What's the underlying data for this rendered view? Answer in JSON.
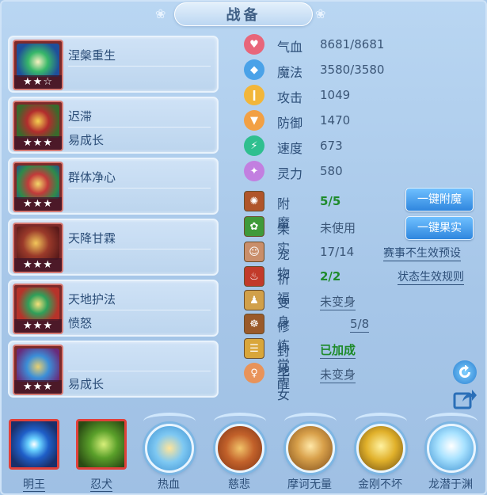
{
  "title": "战备",
  "skills": [
    {
      "line1": "涅槃重生",
      "line2": "",
      "stars": "★★☆"
    },
    {
      "line1": "迟滞",
      "line2": "易成长",
      "stars": "★★★"
    },
    {
      "line1": "群体净心",
      "line2": "",
      "stars": "★★★"
    },
    {
      "line1": "天降甘霖",
      "line2": "",
      "stars": "★★★"
    },
    {
      "line1": "天地护法",
      "line2": "愤怒",
      "stars": "★★★"
    },
    {
      "line1": "",
      "line2": "易成长",
      "stars": "★★★"
    }
  ],
  "attributes": [
    {
      "label": "气血",
      "value": "8681/8681",
      "icon": "heart-icon",
      "color": "#e8667a"
    },
    {
      "label": "魔法",
      "value": "3580/3580",
      "icon": "mana-icon",
      "color": "#4aa2e8"
    },
    {
      "label": "攻击",
      "value": "1049",
      "icon": "sword-icon",
      "color": "#f2b63a"
    },
    {
      "label": "防御",
      "value": "1470",
      "icon": "shield-icon",
      "color": "#f2a044"
    },
    {
      "label": "速度",
      "value": "673",
      "icon": "lightning-icon",
      "color": "#2fbf8f"
    },
    {
      "label": "灵力",
      "value": "580",
      "icon": "spirit-icon",
      "color": "#c27fe0"
    }
  ],
  "status": {
    "enchant": {
      "label": "附魔",
      "value": "5/5"
    },
    "fruit": {
      "label": "果实",
      "value": "未使用"
    },
    "pet": {
      "label": "宠物",
      "value": "17/14"
    },
    "bless": {
      "label": "祈福",
      "value": "2/2"
    },
    "transform": {
      "label": "变身",
      "value": "未变身"
    },
    "cultivate": {
      "label": "修炼觉醒",
      "value": "5/8"
    },
    "seal": {
      "label": "封地",
      "value": "已加成"
    },
    "child": {
      "label": "子女",
      "value": "未变身"
    }
  },
  "buttons": {
    "enchant_all": "一键附魔",
    "fruit_all": "一键果实"
  },
  "links": {
    "event_preset": "赛事不生效预设",
    "status_rule": "状态生效规则"
  },
  "bottom_skills": [
    {
      "name": "明王",
      "style": "square"
    },
    {
      "name": "忍犬",
      "style": "square"
    },
    {
      "name": "热血",
      "style": "round"
    },
    {
      "name": "慈悲",
      "style": "round"
    },
    {
      "name": "摩诃无量",
      "style": "round"
    },
    {
      "name": "金刚不坏",
      "style": "round"
    },
    {
      "name": "龙潜于渊",
      "style": "round"
    }
  ],
  "colors": {
    "accent_green": "#1e8b2b",
    "button_blue": "#2f86de",
    "frame_red": "#e0403a"
  }
}
